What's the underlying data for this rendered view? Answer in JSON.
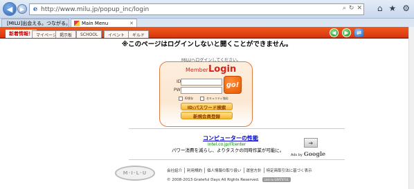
{
  "browser": {
    "url": "http://www.milu.jp/popup_inc/login",
    "tabs": [
      {
        "label": "[MILU]出会える。つながる。楽..."
      },
      {
        "label": "Main Menu"
      }
    ],
    "icons": [
      "back-icon",
      "forward-icon",
      "home-icon",
      "star-icon",
      "gear-icon"
    ]
  },
  "site_header": {
    "news_label": "新着情報！",
    "tabs": [
      "マイページ",
      "掲示板",
      "SCHOOL",
      "イベント",
      "ギルド"
    ],
    "colors": {
      "accent": "#e2461a"
    }
  },
  "warning": "※このページはログインしないと開くことができません。",
  "login": {
    "prompt": "MILUへログインしてください。",
    "member_label": "Member",
    "title": "Login",
    "id_label": "ID",
    "pw_label": "PW",
    "go_label": "go!",
    "remember_label": "ID保存",
    "secure_label": "セキュリティ強化",
    "forgot_label": "ID/パスワード検索",
    "register_label": "新規会員登録"
  },
  "ad": {
    "title": "コンピューターの性能",
    "url": "Intel.co.jp/ITcenter",
    "description": "パワー消費を減らし、よりタスクの同時作業が可能に。",
    "ads_by": "Ads by",
    "google": "Google"
  },
  "footer": {
    "logo_text": "M·I·L·U",
    "links": [
      "会社紹介",
      "利用規約",
      "個人情報の取り扱い",
      "運営方針",
      "特定商取引法に基づく表示"
    ],
    "copyright": "© 2008-2013 Grateful Days All Rights Reserved.",
    "badge": "Link to GRATEFUL"
  }
}
